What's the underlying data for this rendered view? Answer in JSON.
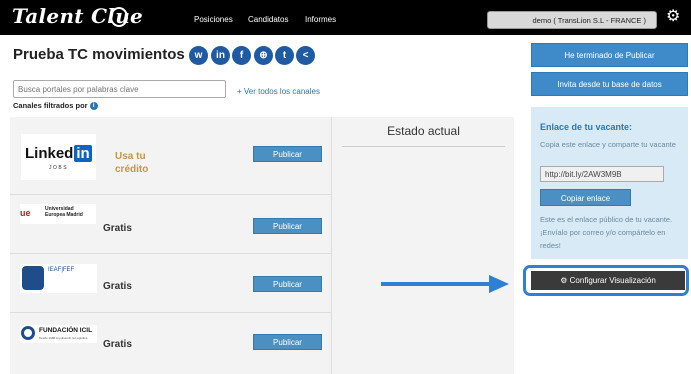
{
  "header": {
    "logo_text": "Talent Clue",
    "nav": [
      "Posiciones",
      "Candidatos",
      "Informes"
    ],
    "user": "demo ( TransLion S.L - FRANCE )"
  },
  "page": {
    "title": "Prueba TC movimientos",
    "social_icons": [
      "whatsapp-icon",
      "linkedin-icon",
      "facebook-icon",
      "web-icon",
      "twitter-icon",
      "share-icon"
    ],
    "social_glyphs": [
      "w",
      "in",
      "f",
      "⊕",
      "t",
      "<"
    ]
  },
  "filters": {
    "search_placeholder": "Busca portales por palabras clave",
    "ver_todos": "+ Ver todos los canales",
    "canales_filtrados": "Canales filtrados por"
  },
  "channels": [
    {
      "name": "LinkedIn Jobs",
      "logo_main": "Linked",
      "logo_in": "in",
      "logo_sub": "JOBS",
      "price": "Usa tu crédito",
      "button": "Publicar"
    },
    {
      "name": "Universidad Europea Madrid",
      "logo_line1": "Universidad",
      "logo_line2": "Europea Madrid",
      "price": "Gratis",
      "button": "Publicar"
    },
    {
      "name": "IEAF FEF",
      "logo_text": "IEAF|FEF",
      "price": "Gratis",
      "button": "Publicar"
    },
    {
      "name": "Fundación ICIL",
      "logo_text": "FUNDACIÓN ICIL",
      "logo_sub": "Desde 1980 impulsando la Logística",
      "price": "Gratis",
      "button": "Publicar"
    }
  ],
  "estado": {
    "title": "Estado actual"
  },
  "sidebar": {
    "btn_terminado": "He terminado de Publicar",
    "btn_invita": "Invita desde tu base de datos",
    "enlace_title": "Enlace de tu vacante:",
    "enlace_desc": "Copia este enlace y comparte tu vacante",
    "enlace_url": "http://bit.ly/2AW3M9B",
    "copiar": "Copiar enlace",
    "enlace_note": "Este es el enlace público de tu vacante. ¡Envíalo por correo y/o compártelo en redes!",
    "config": "Configurar Visualización"
  },
  "colors": {
    "accent": "#3f8bc9",
    "highlight": "#2f7fd4",
    "credit": "#c4944a"
  }
}
